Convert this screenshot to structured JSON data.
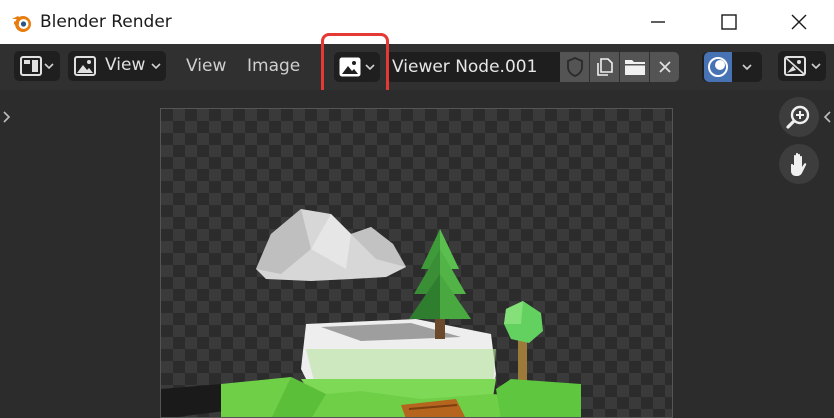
{
  "window": {
    "title": "Blender Render",
    "minimize_icon": "minimize-icon",
    "maximize_icon": "maximize-icon",
    "close_icon": "close-icon"
  },
  "header": {
    "editor_type_icon": "image-editor-icon",
    "view_mode_label": "View",
    "menus": [
      "View",
      "Image"
    ],
    "browse_image_icon": "image-browse-icon",
    "image_name": "Viewer Node.001",
    "fake_user_icon": "shield-icon",
    "new_image_icon": "duplicate-icon",
    "open_image_icon": "folder-icon",
    "unlink_icon": "x-icon",
    "overlay_icon": "overlay-icon",
    "display_channels_icon": "display-channels-icon"
  },
  "viewport": {
    "zoom_icon": "zoom-in-icon",
    "pan_icon": "hand-icon",
    "left_toggle_icon": "chevron-right-icon",
    "right_toggle_icon": "chevron-left-icon"
  },
  "colors": {
    "highlight": "#e53935",
    "accent": "#4772b3",
    "logo_orange": "#e87d0d"
  }
}
